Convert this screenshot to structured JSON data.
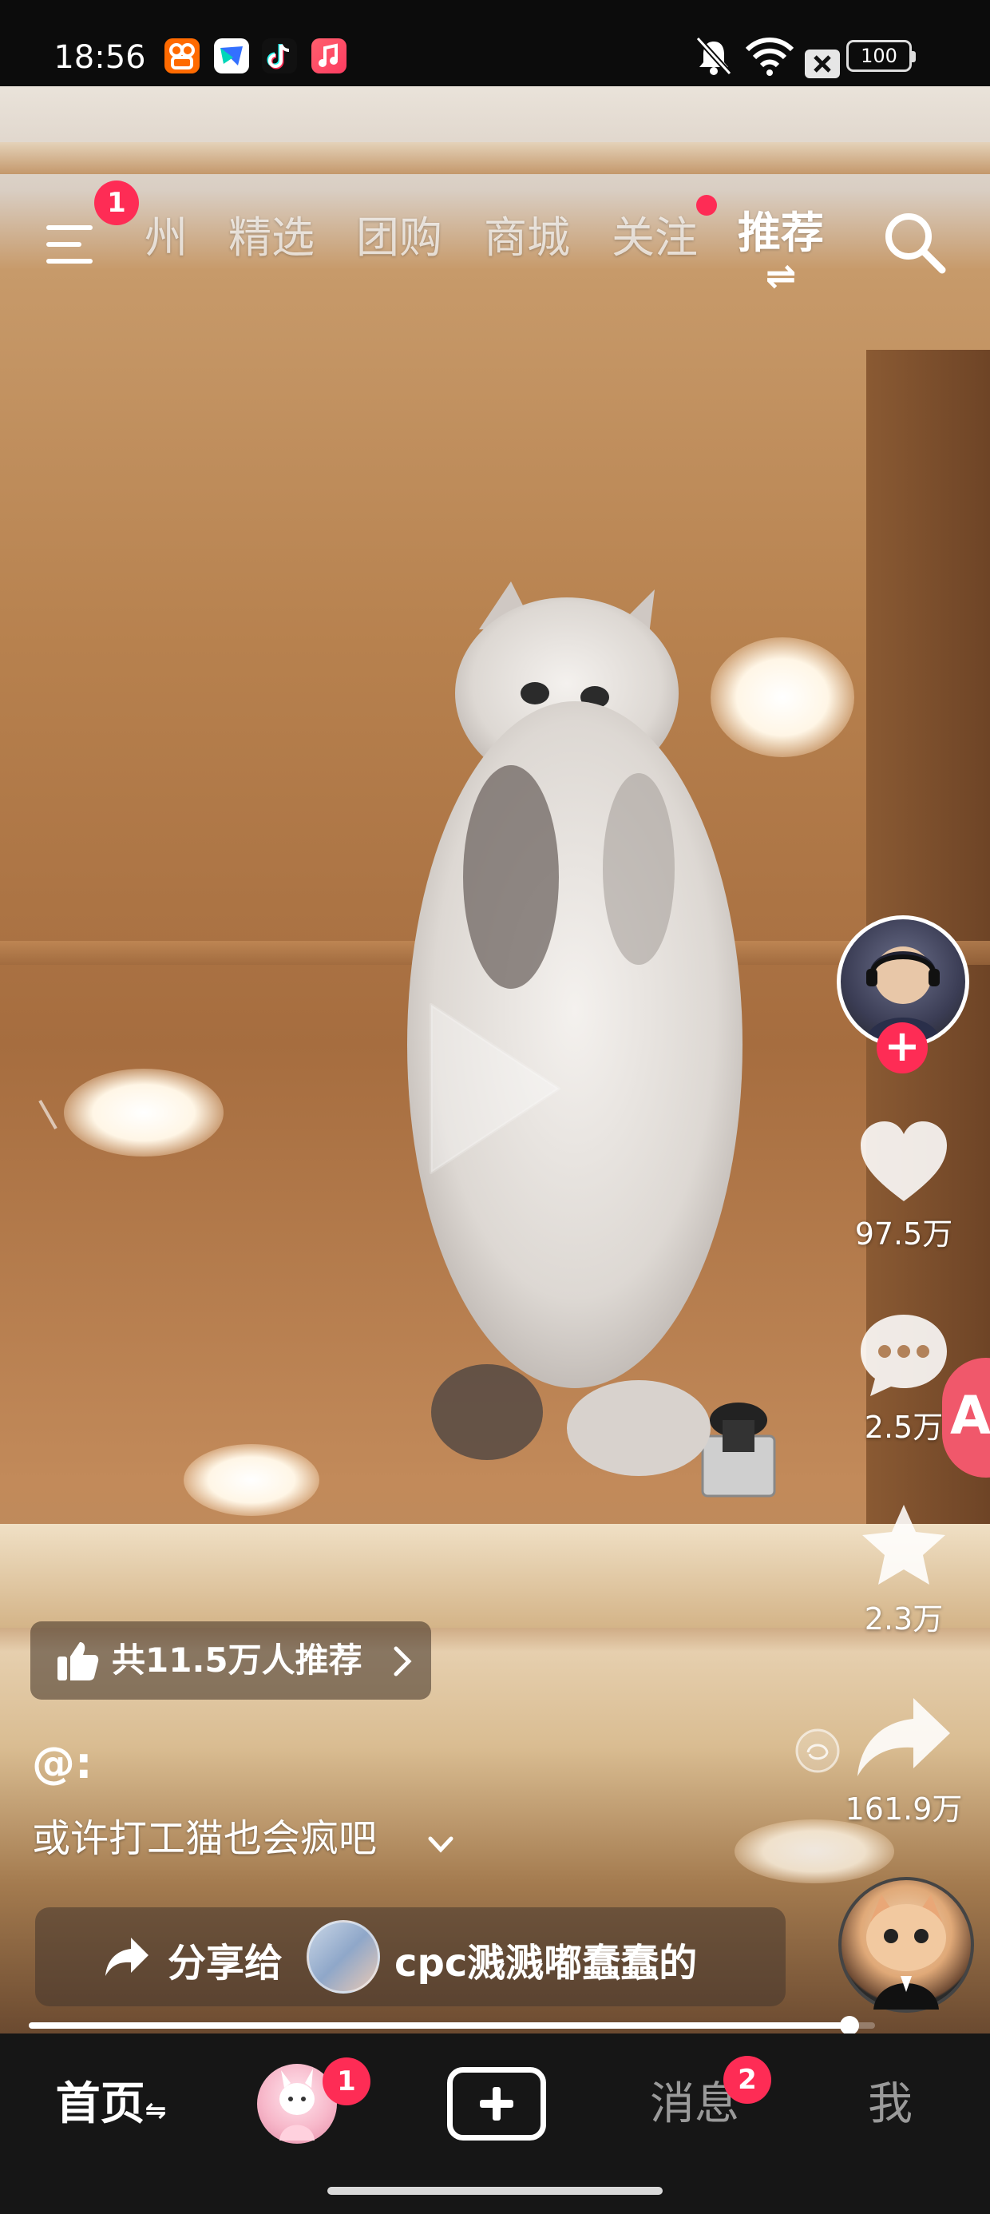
{
  "status_bar": {
    "time": "18:56",
    "apps": [
      "kuaishou-app-icon",
      "feishu-app-icon",
      "douyin-app-icon",
      "music-app-icon"
    ],
    "battery": "100"
  },
  "top_nav": {
    "menu_badge": "1",
    "tabs": [
      {
        "label": "州",
        "active": false
      },
      {
        "label": "精选",
        "active": false
      },
      {
        "label": "团购",
        "active": false
      },
      {
        "label": "商城",
        "active": false
      },
      {
        "label": "关注",
        "active": false,
        "dot": true
      },
      {
        "label": "推荐",
        "active": true
      }
    ],
    "refresh_glyph": "⇌"
  },
  "right_rail": {
    "like_count": "97.5万",
    "comment_count": "2.5万",
    "favorite_count": "2.3万",
    "share_count": "161.9万",
    "side_badge": "A"
  },
  "video_info": {
    "recommend_text": "共11.5万人推荐",
    "author": "@:",
    "caption": "或许打工猫也会疯吧"
  },
  "share_bar": {
    "label": "分享给",
    "recipient_name": "cpc溅溅嘟蠢蠢的"
  },
  "playback": {
    "progress_fraction": 0.97
  },
  "bottom_nav": {
    "home_label": "首页",
    "home_switch_glyph": "⇋",
    "friends_badge": "1",
    "messages_label": "消息",
    "messages_badge": "2",
    "me_label": "我"
  },
  "colors": {
    "accent": "#fe2c55",
    "nav_bg": "#161616"
  }
}
